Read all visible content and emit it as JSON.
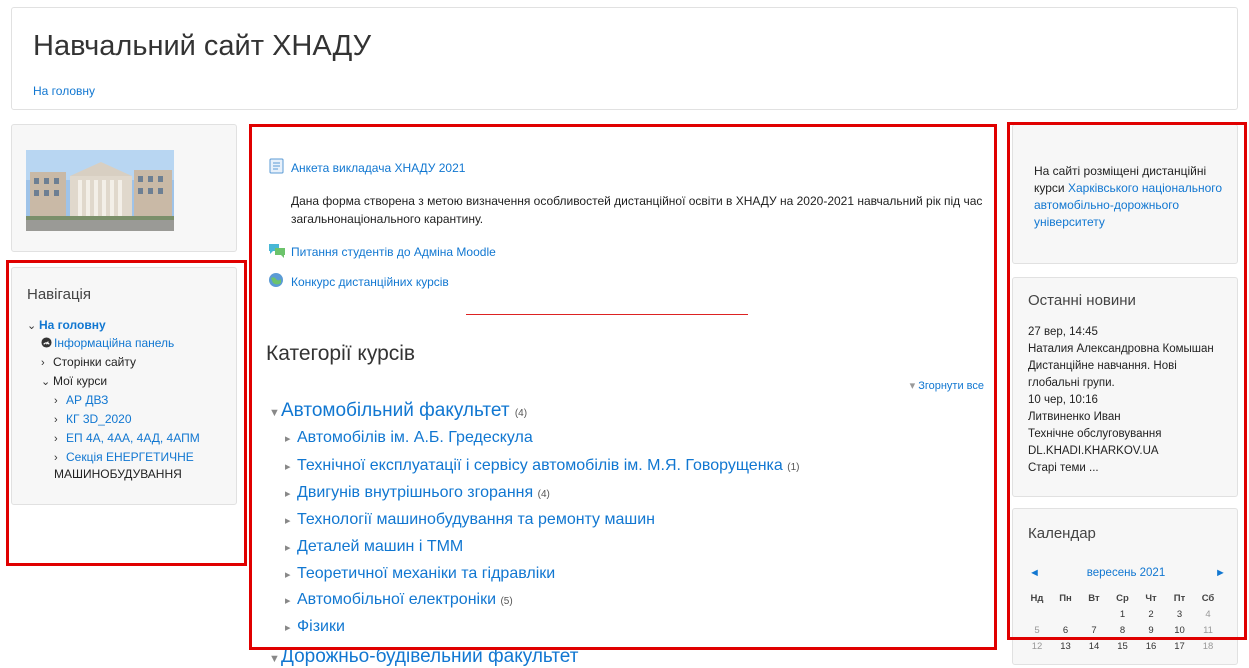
{
  "header": {
    "site_title": "Навчальний сайт ХНАДУ",
    "home_link": "На головну"
  },
  "navigation": {
    "title": "Навігація",
    "items": [
      {
        "label": "На головну"
      },
      {
        "label": "Інформаційна панель"
      },
      {
        "label": "Сторінки сайту"
      },
      {
        "label": "Мої курси"
      },
      {
        "label": "АР ДВЗ"
      },
      {
        "label": "КГ 3D_2020"
      },
      {
        "label": "ЕП 4А, 4АА, 4АД, 4АПМ"
      },
      {
        "label": "Секція ЕНЕРГЕТИЧНЕ"
      },
      {
        "label": "МАШИНОБУДУВАННЯ"
      }
    ]
  },
  "main": {
    "activities": [
      {
        "label": "Анкета викладача ХНАДУ 2021",
        "icon": "feedback-icon"
      },
      {
        "label": "Питання студентів до Адміна Moodle",
        "icon": "forum-icon"
      },
      {
        "label": "Конкурс дистанційних курсів",
        "icon": "url-icon"
      }
    ],
    "description_line1": "Дана форма створена з метою визначення особливостей дистанційної освіти в ХНАДУ на 2020-2021 навчальний рік під час",
    "description_line2": "загальнонаціонального карантину.",
    "categories_title": "Категорії курсів",
    "collapse_all": "Згорнути все",
    "categories": [
      {
        "label": "Автомобільний факультет",
        "count": "(4)"
      },
      {
        "label": "Автомобілів ім. А.Б. Гредескула",
        "count": ""
      },
      {
        "label": "Технічної експлуатації і сервісу автомобілів ім. М.Я. Говорущенка",
        "count": "(1)"
      },
      {
        "label": "Двигунів внутрішнього згорання",
        "count": "(4)"
      },
      {
        "label": "Технології машинобудування та ремонту машин",
        "count": ""
      },
      {
        "label": "Деталей машин і ТММ",
        "count": ""
      },
      {
        "label": "Теоретичної механіки та гідравліки",
        "count": ""
      },
      {
        "label": "Автомобільної електроніки",
        "count": "(5)"
      },
      {
        "label": "Фізики",
        "count": ""
      },
      {
        "label": "Дорожньо-будівельний факультет",
        "count": ""
      }
    ]
  },
  "info": {
    "text_plain": "На сайті розміщені дистанційні курси",
    "text_link": "Харківського національного автомобільно-дорожнього університету"
  },
  "news": {
    "title": "Останні новини",
    "items": [
      {
        "date": "27 вер, 14:45",
        "author": "Наталия Александровна Комышан",
        "title1": "Дистанційне навчання. Нові",
        "title2": "глобальні групи."
      },
      {
        "date": "10 чер, 10:16",
        "author": "Литвиненко Иван",
        "title1": "Технічне обслуговування",
        "title2": "DL.KHADI.KHARKOV.UA"
      }
    ],
    "older": "Старі теми ..."
  },
  "calendar": {
    "title": "Календар",
    "month": "вересень 2021",
    "prev": "◄",
    "next": "►",
    "weekdays": [
      "Нд",
      "Пн",
      "Вт",
      "Ср",
      "Чт",
      "Пт",
      "Сб"
    ],
    "weeks": [
      [
        "",
        "",
        "",
        "1",
        "2",
        "3",
        "4"
      ],
      [
        "5",
        "6",
        "7",
        "8",
        "9",
        "10",
        "11"
      ],
      [
        "12",
        "13",
        "14",
        "15",
        "16",
        "17",
        "18"
      ]
    ]
  },
  "colors": {
    "link": "#1177d1",
    "highlight_frame": "#e00000"
  }
}
